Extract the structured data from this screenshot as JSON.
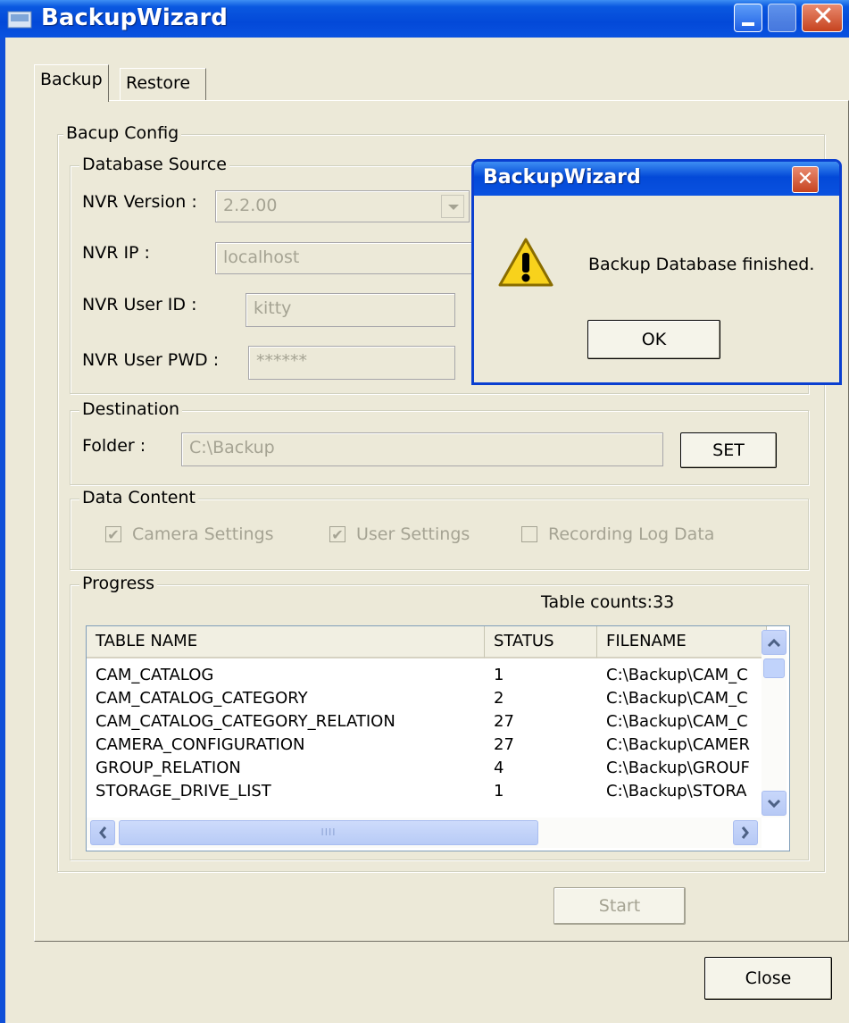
{
  "window": {
    "title": "BackupWizard"
  },
  "tabs": [
    {
      "label": "Backup",
      "active": true
    },
    {
      "label": "Restore",
      "active": false
    }
  ],
  "backup_config": {
    "legend": "Bacup Config",
    "database_source": {
      "legend": "Database Source",
      "nvr_version_label": "NVR Version :",
      "nvr_version_value": "2.2.00",
      "nvr_ip_label": "NVR IP :",
      "nvr_ip_value": "localhost",
      "nvr_user_id_label": "NVR User ID :",
      "nvr_user_id_value": "kitty",
      "nvr_user_pwd_label": "NVR User PWD :",
      "nvr_user_pwd_value": "******"
    },
    "destination": {
      "legend": "Destination",
      "folder_label": "Folder :",
      "folder_value": "C:\\Backup",
      "set_label": "SET"
    },
    "data_content": {
      "legend": "Data Content",
      "options": [
        {
          "label": "Camera Settings",
          "checked": true
        },
        {
          "label": "User Settings",
          "checked": true
        },
        {
          "label": "Recording Log Data",
          "checked": false
        }
      ]
    },
    "progress": {
      "legend": "Progress",
      "table_counts": "Table counts:33",
      "columns": [
        "TABLE NAME",
        "STATUS",
        "FILENAME"
      ],
      "rows": [
        [
          "CAM_CATALOG",
          "1",
          "C:\\Backup\\CAM_C"
        ],
        [
          "CAM_CATALOG_CATEGORY",
          "2",
          "C:\\Backup\\CAM_C"
        ],
        [
          "CAM_CATALOG_CATEGORY_RELATION",
          "27",
          "C:\\Backup\\CAM_C"
        ],
        [
          "CAMERA_CONFIGURATION",
          "27",
          "C:\\Backup\\CAMER"
        ],
        [
          "GROUP_RELATION",
          "4",
          "C:\\Backup\\GROUF"
        ],
        [
          "STORAGE_DRIVE_LIST",
          "1",
          "C:\\Backup\\STORA"
        ]
      ],
      "scrollbar_grip": "IIII"
    },
    "start_label": "Start"
  },
  "close_label": "Close",
  "dialog": {
    "title": "BackupWizard",
    "message": "Backup Database finished.",
    "ok_label": "OK",
    "icon": "warning-icon"
  }
}
